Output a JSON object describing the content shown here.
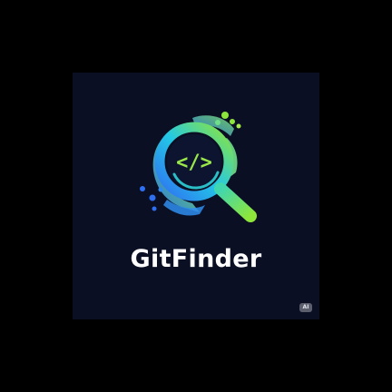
{
  "brand": {
    "name": "GitFinder",
    "code_glyph": "</>"
  },
  "corner_badge": {
    "label": "AI"
  },
  "colors": {
    "page_background": "#000000",
    "card_background": "#0b0f24",
    "gradient_start": "#2f6ff2",
    "gradient_mid": "#23c8e6",
    "gradient_end": "#8ee63a",
    "wordmark": "#ffffff"
  },
  "icons": [
    "magnifier-icon",
    "code-brackets-icon"
  ]
}
